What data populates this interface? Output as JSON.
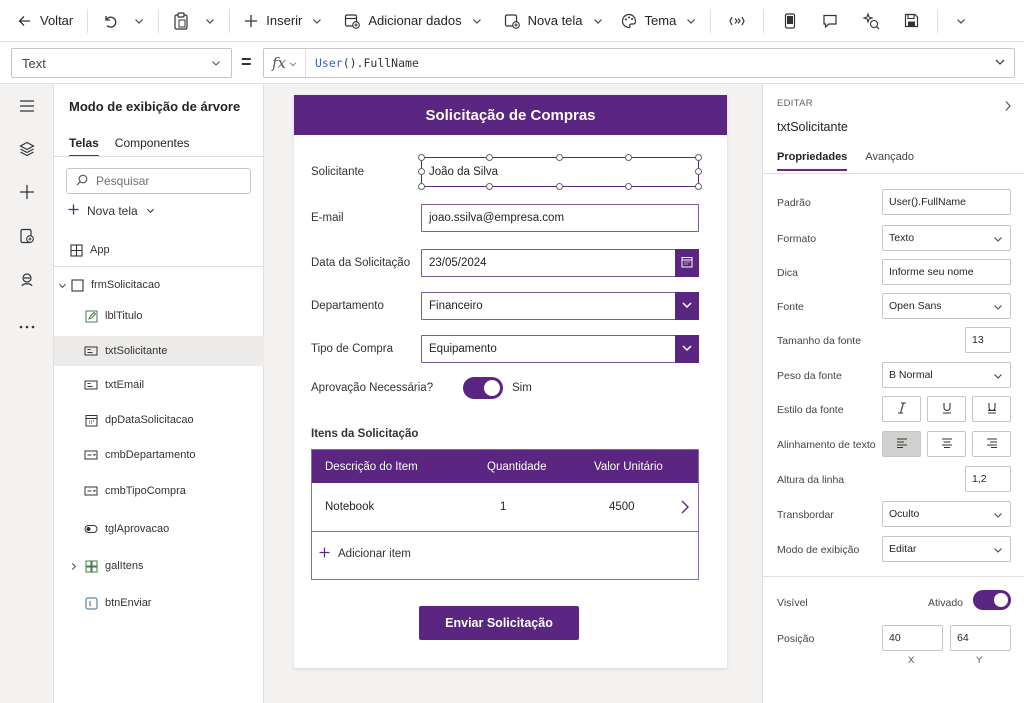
{
  "toolbar": {
    "back": "Voltar",
    "insert": "Inserir",
    "add_data": "Adicionar dados",
    "new_screen": "Nova tela",
    "theme": "Tema"
  },
  "formula": {
    "property": "Text",
    "fx": "fx",
    "expr_fn": "User",
    "expr_rest": "().FullName"
  },
  "tree": {
    "title": "Modo de exibição de árvore",
    "tabs": [
      "Telas",
      "Componentes"
    ],
    "search_placeholder": "Pesquisar",
    "new_screen": "Nova tela",
    "app": "App",
    "form": "frmSolicitacao",
    "items": [
      "lblTitulo",
      "txtSolicitante",
      "txtEmail",
      "dpDataSolicitacao",
      "cmbDepartamento",
      "cmbTipoCompra",
      "tglAprovacao",
      "galItens",
      "btnEnviar"
    ]
  },
  "form": {
    "header": "Solicitação de Compras",
    "labels": {
      "requester": "Solicitante",
      "email": "E-mail",
      "date": "Data da Solicitação",
      "department": "Departamento",
      "type": "Tipo de Compra",
      "approval": "Aprovação Necessária?"
    },
    "values": {
      "requester": "João da Silva",
      "email": "joao.ssilva@empresa.com",
      "date": "23/05/2024",
      "department": "Financeiro",
      "type": "Equipamento"
    },
    "approval_on": true,
    "approval_label": "Sim",
    "items_title": "Itens da Solicitação",
    "columns": [
      "Descrição do Item",
      "Quantidade",
      "Valor Unitário"
    ],
    "rows": [
      [
        "Notebook",
        "1",
        "4500"
      ]
    ],
    "add_item": "Adicionar item",
    "submit": "Enviar Solicitação"
  },
  "props": {
    "edit_label": "EDITAR",
    "control_name": "txtSolicitante",
    "tabs": [
      "Propriedades",
      "Avançado"
    ],
    "rows": {
      "default": {
        "label": "Padrão",
        "value": "User().FullName"
      },
      "format": {
        "label": "Formato",
        "value": "Texto"
      },
      "hint": {
        "label": "Dica",
        "value": "Informe seu nome"
      },
      "font": {
        "label": "Fonte",
        "value": "Open Sans"
      },
      "font_size": {
        "label": "Tamanho da fonte",
        "value": "13"
      },
      "font_weight": {
        "label": "Peso da fonte",
        "value": "B  Normal"
      },
      "font_style": {
        "label": "Estilo da fonte"
      },
      "text_align": {
        "label": "Alinhamento de texto"
      },
      "line_height": {
        "label": "Altura da linha",
        "value": "1,2"
      },
      "overflow": {
        "label": "Transbordar",
        "value": "Oculto"
      },
      "display_mode": {
        "label": "Modo de exibição",
        "value": "Editar"
      }
    },
    "visible": {
      "label": "Visível",
      "value": "Ativado"
    },
    "position": {
      "label": "Posição",
      "x": "40",
      "y": "64",
      "x_label": "X",
      "y_label": "Y"
    }
  },
  "colors": {
    "accent": "#5b2582",
    "tab_underline": "#742774"
  }
}
